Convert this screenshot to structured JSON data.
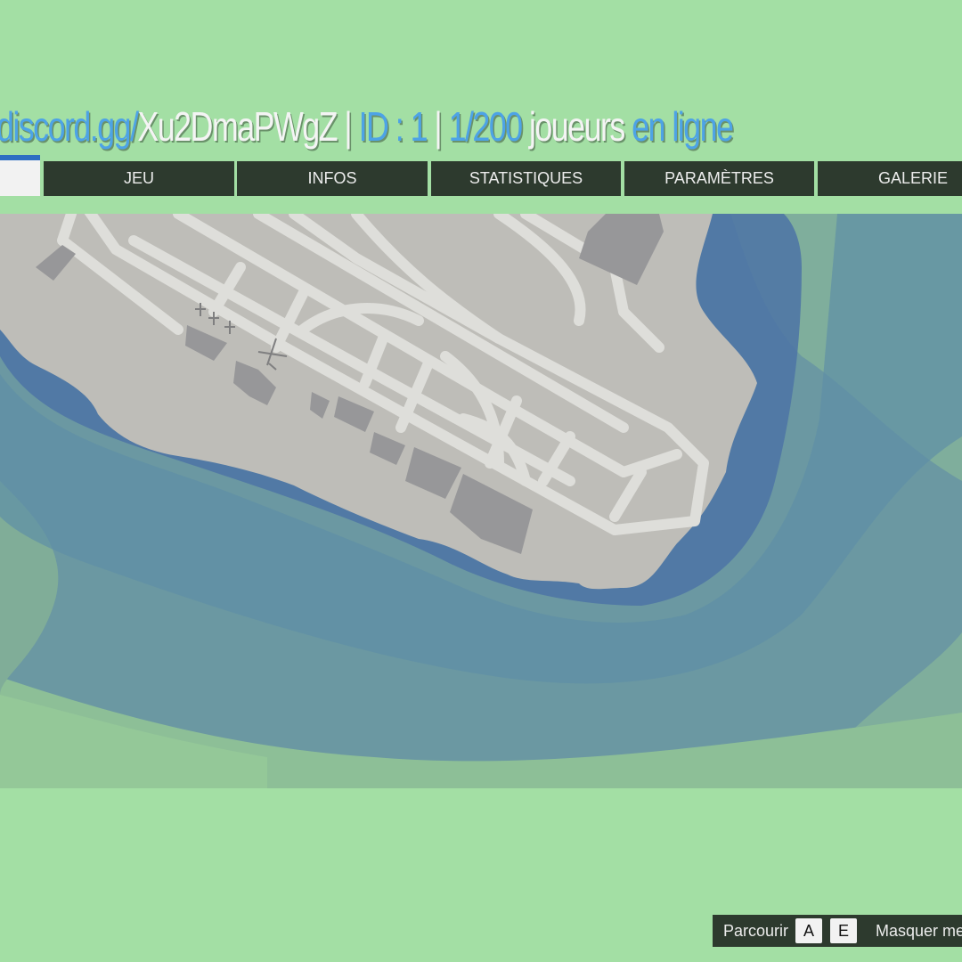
{
  "header": {
    "server_link": "discord.gg/",
    "server_code": "Xu2DmaPWgZ",
    "separator": "|",
    "id_label": "ID : 1",
    "player_count": "1/200",
    "players_word": "joueurs",
    "online_word": "en ligne"
  },
  "tabs": [
    {
      "label": "JEU"
    },
    {
      "label": "INFOS"
    },
    {
      "label": "STATISTIQUES"
    },
    {
      "label": "PARAMÈTRES"
    },
    {
      "label": "GALERIE"
    }
  ],
  "hints": {
    "browse_label": "Parcourir",
    "key_a": "A",
    "key_e": "E",
    "hide_menu_label": "Masquer menu"
  },
  "colors": {
    "background": "#a3dfa4",
    "tab_background": "#2d3a2e",
    "accent": "#2e6fc2",
    "title_blue": "#4da3e6",
    "water": "#5d8fa0",
    "land": "#bdbdbd"
  },
  "map": {
    "area": "airport-island"
  }
}
